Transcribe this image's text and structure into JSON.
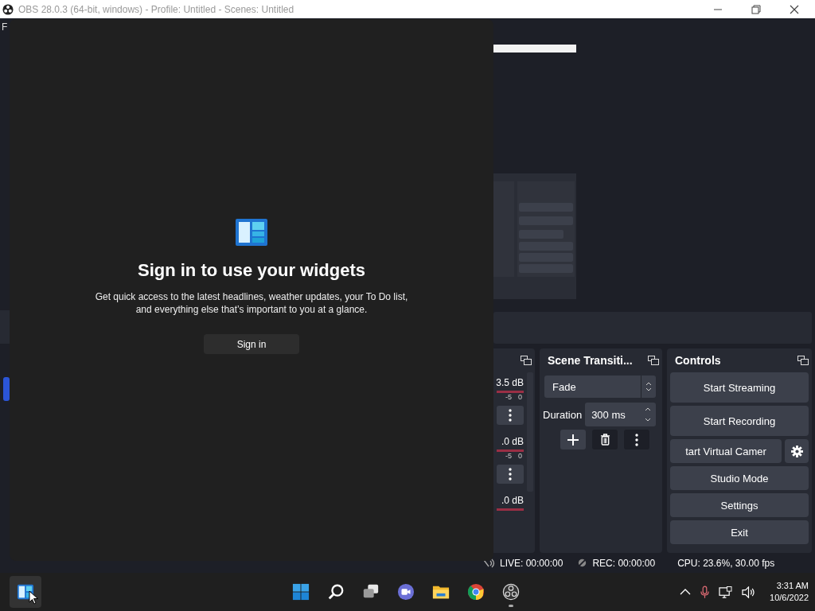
{
  "obs_window": {
    "title": "OBS 28.0.3 (64-bit, windows) - Profile: Untitled - Scenes: Untitled",
    "menu": [
      "F"
    ]
  },
  "audio_mixer": {
    "channels": [
      {
        "reading": "3.5 dB",
        "scale": [
          "-5",
          "0"
        ]
      },
      {
        "reading": ".0 dB",
        "scale": [
          "-5",
          "0"
        ]
      },
      {
        "reading": ".0 dB"
      }
    ]
  },
  "scene_transitions": {
    "title": "Scene Transiti...",
    "transition": "Fade",
    "duration_label": "Duration",
    "duration": "300 ms"
  },
  "controls": {
    "title": "Controls",
    "buttons": [
      {
        "label": "Start Streaming",
        "kind": "plain"
      },
      {
        "label": "Start Recording",
        "kind": "plain"
      },
      {
        "label": "tart Virtual Camer",
        "kind": "with-settings"
      },
      {
        "label": "Studio Mode",
        "kind": "plain"
      },
      {
        "label": "Settings",
        "kind": "plain"
      },
      {
        "label": "Exit",
        "kind": "plain"
      }
    ]
  },
  "status_bar": {
    "live": "LIVE: 00:00:00",
    "rec": "REC: 00:00:00",
    "cpu": "CPU: 23.6%, 30.00 fps"
  },
  "widgets_panel": {
    "heading": "Sign in to use your widgets",
    "text": "Get quick access to the latest headlines, weather updates, your To Do list, and everything else that’s important to you at a glance.",
    "button": "Sign in"
  },
  "taskbar": {
    "widgets": {
      "selected": true
    },
    "apps": [
      {
        "kind": "start",
        "running": false
      },
      {
        "kind": "search",
        "running": false
      },
      {
        "kind": "task-view",
        "running": false
      },
      {
        "kind": "chat",
        "running": false
      },
      {
        "kind": "explorer",
        "running": false
      },
      {
        "kind": "chrome",
        "running": false
      },
      {
        "kind": "obs",
        "running": true
      }
    ],
    "clock": {
      "time": "3:31 AM",
      "date": "10/6/2022"
    }
  }
}
